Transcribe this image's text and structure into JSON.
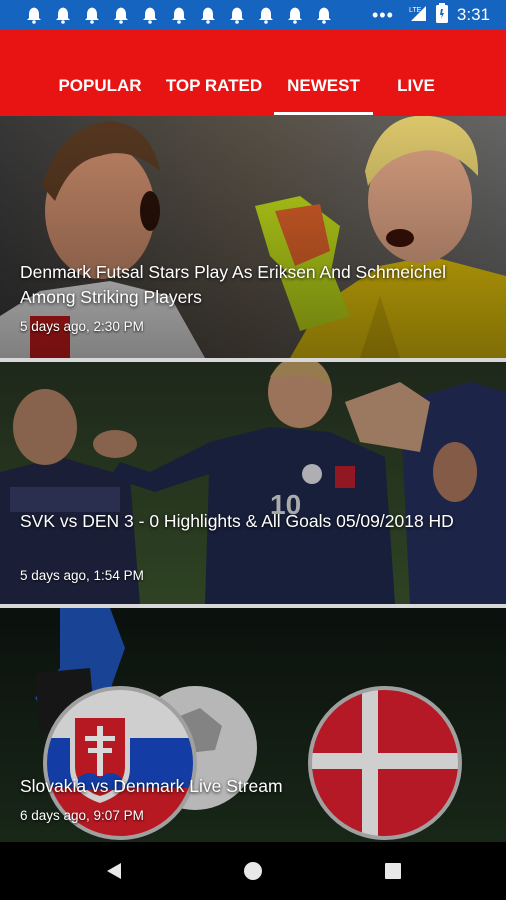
{
  "status_bar": {
    "time": "3:31",
    "network": "LTE",
    "notification_icon": "bell-icon",
    "notification_count": 11
  },
  "tabs": [
    {
      "label": "POPULAR",
      "active": false
    },
    {
      "label": "TOP RATED",
      "active": false
    },
    {
      "label": "NEWEST",
      "active": true
    },
    {
      "label": "LIVE",
      "active": false
    }
  ],
  "articles": [
    {
      "title": "Denmark Futsal Stars Play As Eriksen And Schmeichel Among Striking Players",
      "time": "5 days ago, 2:30 PM"
    },
    {
      "title": "SVK vs DEN 3 - 0 Highlights & All Goals 05/09/2018 HD",
      "time": "5 days ago, 1:54 PM"
    },
    {
      "title": "Slovakia vs Denmark Live Stream",
      "time": "6 days ago, 9:07 PM"
    }
  ],
  "colors": {
    "status_bar": "#1565c0",
    "header": "#e81414",
    "nav_bar": "#000000"
  }
}
